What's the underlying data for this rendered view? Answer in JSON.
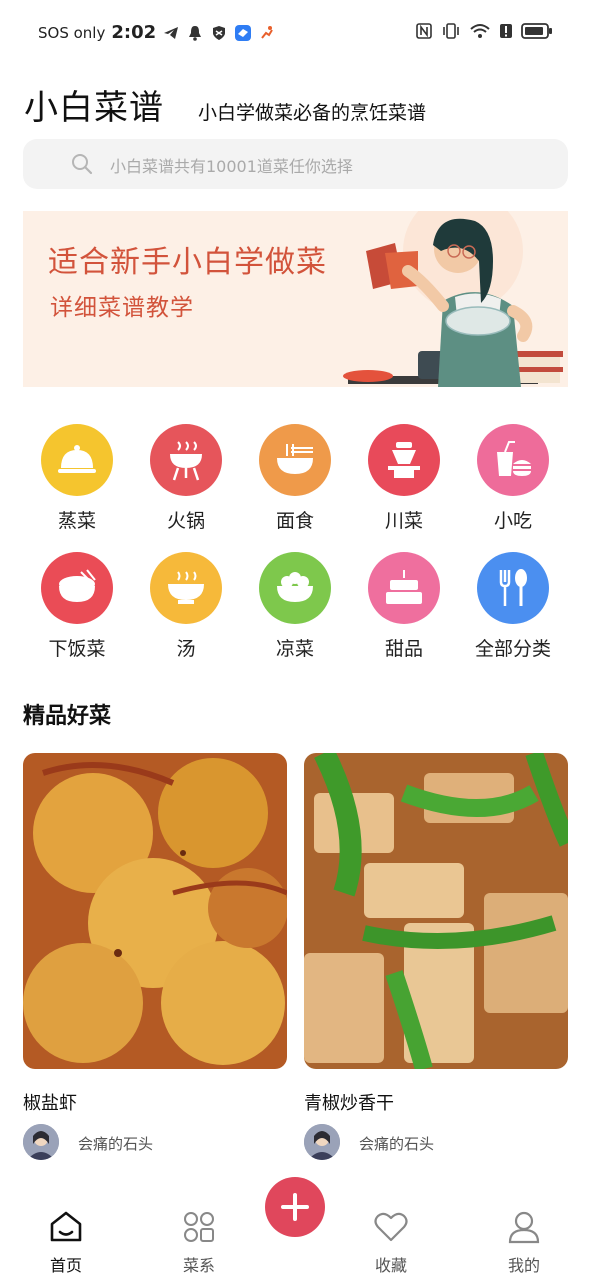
{
  "status_bar": {
    "carrier": "SOS only",
    "time": "2:02"
  },
  "header": {
    "title": "小白菜谱",
    "subtitle": "小白学做菜必备的烹饪菜谱"
  },
  "search": {
    "placeholder": "小白菜谱共有10001道菜任你选择"
  },
  "banner": {
    "line1": "适合新手小白学做菜",
    "line2": "详细菜谱教学"
  },
  "categories": [
    {
      "label": "蒸菜",
      "icon": "cloche-icon",
      "color": "#f5c52e"
    },
    {
      "label": "火锅",
      "icon": "grill-icon",
      "color": "#e6555b"
    },
    {
      "label": "面食",
      "icon": "noodle-bowl-icon",
      "color": "#ef9a4a"
    },
    {
      "label": "川菜",
      "icon": "hotpot-icon",
      "color": "#e84a5a"
    },
    {
      "label": "小吃",
      "icon": "fastfood-icon",
      "color": "#ee6c9a"
    },
    {
      "label": "下饭菜",
      "icon": "rice-bowl-icon",
      "color": "#ea4c56"
    },
    {
      "label": "汤",
      "icon": "soup-icon",
      "color": "#f6b93a"
    },
    {
      "label": "凉菜",
      "icon": "salad-bowl-icon",
      "color": "#7ec84c"
    },
    {
      "label": "甜品",
      "icon": "cake-icon",
      "color": "#ef6f9e"
    },
    {
      "label": "全部分类",
      "icon": "utensils-icon",
      "color": "#4b8ff0"
    }
  ],
  "section": {
    "title": "精品好菜"
  },
  "recipes": [
    {
      "title": "椒盐虾",
      "author": "会痛的石头"
    },
    {
      "title": "青椒炒香干",
      "author": "会痛的石头"
    }
  ],
  "nav": {
    "home": "首页",
    "cuisines": "菜系",
    "favorites": "收藏",
    "mine": "我的"
  },
  "colors": {
    "accent": "#e0475c",
    "banner_text": "#d2533b",
    "banner_bg": "#fdf0e6"
  }
}
